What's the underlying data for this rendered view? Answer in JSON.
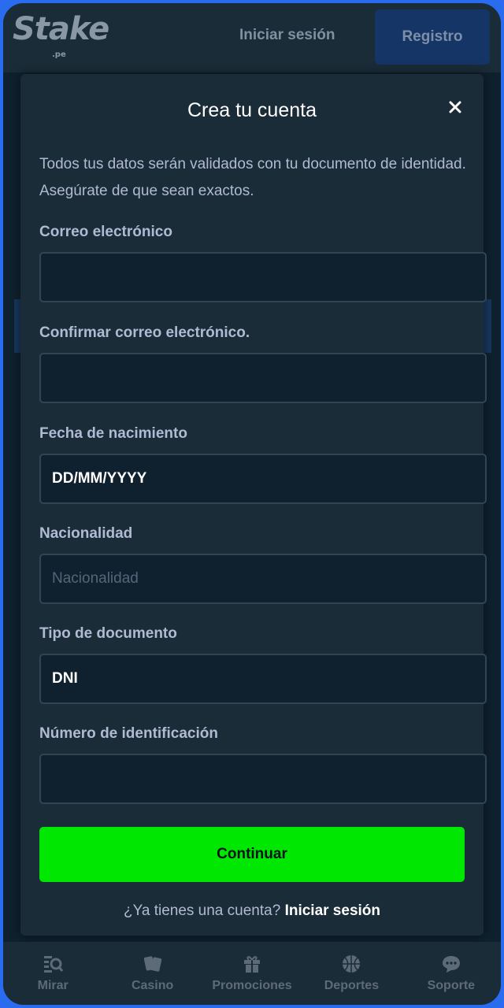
{
  "header": {
    "logo": "Stake",
    "logo_tld": ".pe",
    "login_label": "Iniciar sesión",
    "register_label": "Registro"
  },
  "modal": {
    "title": "Crea tu cuenta",
    "close_icon": "close-icon",
    "intro": "Todos tus datos serán validados con tu documento de identidad. Asegúrate de que sean exactos.",
    "fields": {
      "email": {
        "label": "Correo electrónico",
        "value": ""
      },
      "confirm_email": {
        "label": "Confirmar correo electrónico.",
        "value": ""
      },
      "birthdate": {
        "label": "Fecha de nacimiento",
        "value": "DD/MM/YYYY"
      },
      "nationality": {
        "label": "Nacionalidad",
        "placeholder": "Nacionalidad"
      },
      "doc_type": {
        "label": "Tipo de documento",
        "value": "DNI"
      },
      "id_number": {
        "label": "Número de identificación",
        "value": ""
      }
    },
    "continue_label": "Continuar",
    "footer_question": "¿Ya tienes una cuenta?",
    "footer_link": "Iniciar sesión"
  },
  "bottom_nav": {
    "items": [
      {
        "label": "Mirar",
        "icon": "browse-icon"
      },
      {
        "label": "Casino",
        "icon": "cards-icon"
      },
      {
        "label": "Promociones",
        "icon": "gift-icon"
      },
      {
        "label": "Deportes",
        "icon": "ball-icon"
      },
      {
        "label": "Soporte",
        "icon": "chat-icon"
      }
    ]
  },
  "colors": {
    "accent_green": "#00e701",
    "panel": "#1a2c38",
    "field_bg": "#0f212e"
  }
}
